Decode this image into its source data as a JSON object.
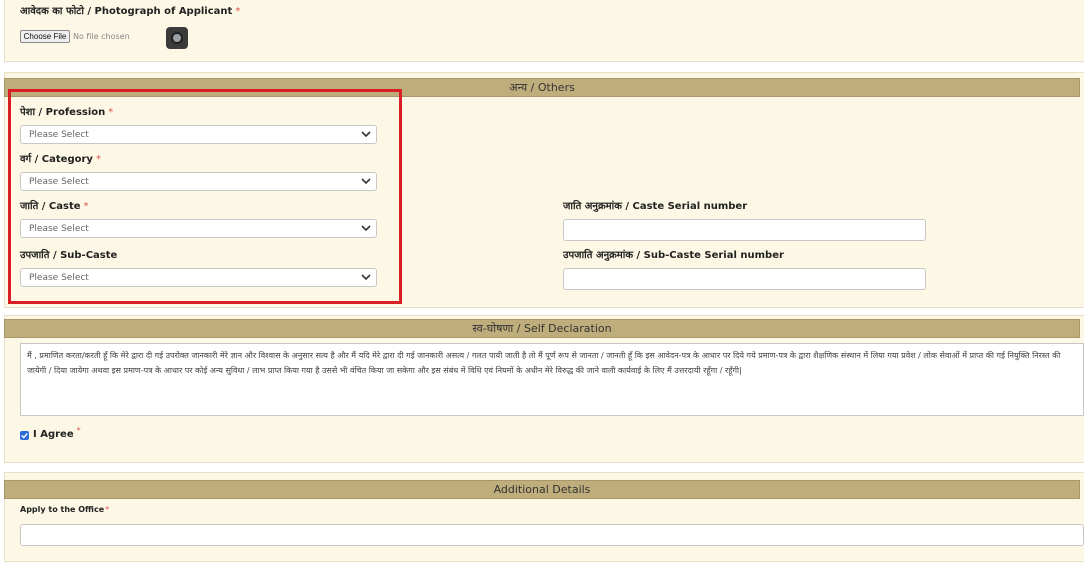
{
  "photo": {
    "label": "आवेदक का फोटो / Photograph of Applicant",
    "required_mark": "*",
    "file_button": "Choose File",
    "file_status": "No file chosen"
  },
  "others": {
    "header": "अन्य / Others",
    "profession_label": "पेशा / Profession",
    "profession_value": "Please Select",
    "category_label": "वर्ग / Category",
    "category_value": "Please Select",
    "caste_label": "जाति / Caste",
    "caste_value": "Please Select",
    "subcaste_label": "उपजाति / Sub-Caste",
    "subcaste_value": "Please Select",
    "caste_serial_label": "जाति अनुक्रमांक / Caste Serial number",
    "subcaste_serial_label": "उपजाति अनुक्रमांक / Sub-Caste Serial number",
    "required_mark": "*"
  },
  "self_declaration": {
    "header": "स्व-घोषणा / Self Declaration",
    "text": "मैं , प्रमाणित करता/करती हूँ कि मेरे द्वारा दी गई उपरोक्त जानकारी मेरे ज्ञान और विश्वास के अनुसार सत्य है और मैं यदि मेरे द्वारा दी गई जानकारी असत्य / गलत पायी जाती है तो मैं पूर्ण रूप से जानता / जानती हूँ कि इस आवेदन-पत्र के आधार पर दिये गये प्रमाण-पत्र के द्वारा शैक्षणिक संस्थान में लिया गया प्रवेश / लोक सेवाओं में प्राप्त की गई नियुक्ति निरस्त की जायेगी / दिया जायेगा अथवा इस प्रमाण-पत्र के आधार पर कोई अन्य सुविधा / लाभ प्राप्त किया गया है उससे भी वंचित किया जा सकेगा और इस संबंध में विधि एवं नियमों के अधीन मेरे विरुद्ध की जाने वाली कार्यवाई के लिए मैं उत्तरदायी रहूँगा / रहूँगी|",
    "agree_label": "I Agree",
    "agree_checked": true,
    "required_mark": "*"
  },
  "additional": {
    "header": "Additional Details",
    "office_label": "Apply to the Office",
    "required_mark": "*"
  },
  "colors": {
    "header_bg": "#bfae7c",
    "panel_bg": "#fdf8e5",
    "highlight": "#d91f26",
    "required": "#d9534f"
  }
}
